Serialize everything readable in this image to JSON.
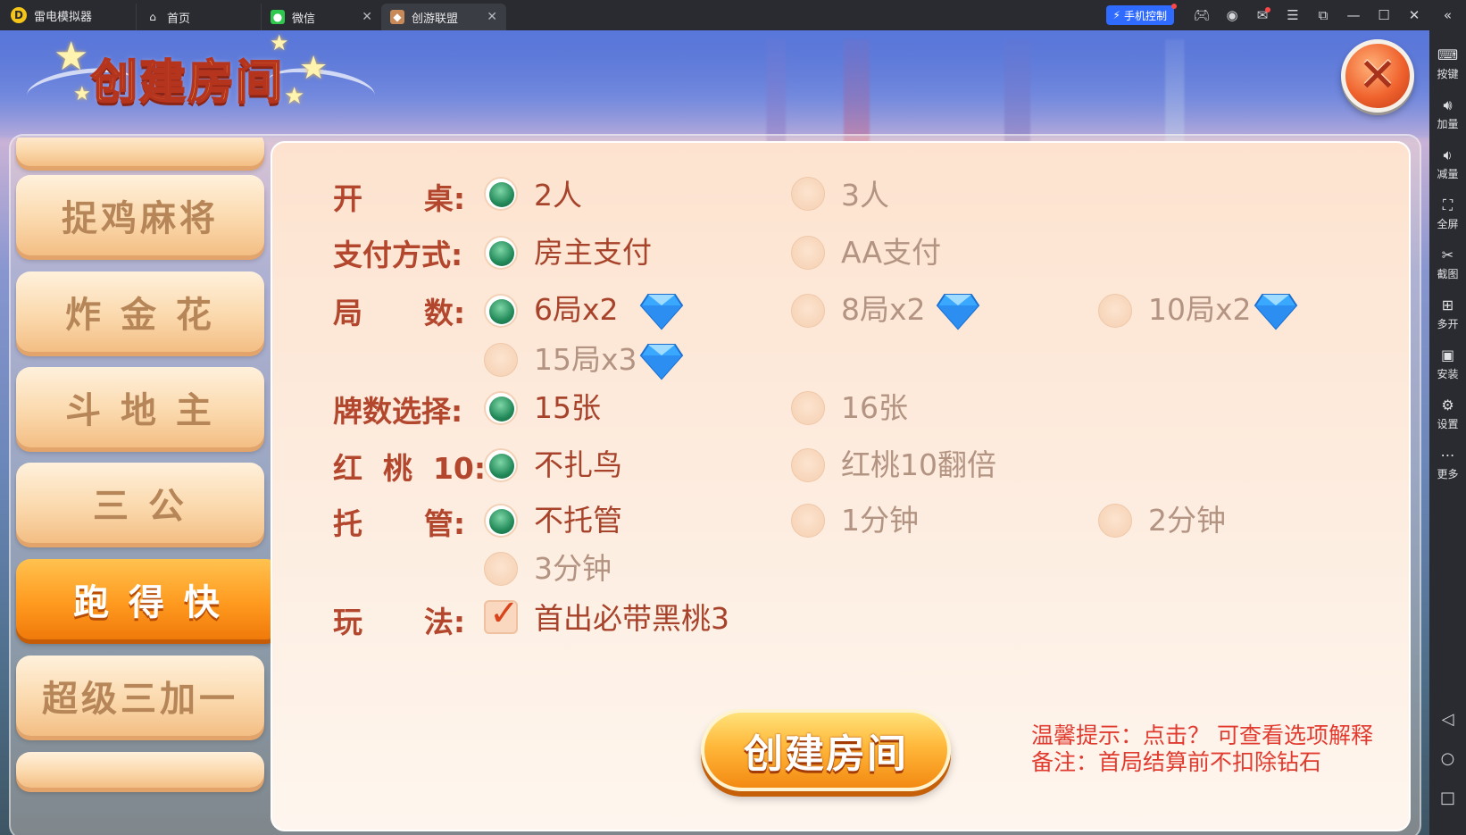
{
  "titlebar": {
    "app_name": "雷电模拟器",
    "tabs": [
      {
        "label": "首页",
        "icon": "home-icon"
      },
      {
        "label": "微信",
        "icon": "wechat-icon"
      },
      {
        "label": "创游联盟",
        "icon": "game-icon"
      }
    ],
    "phone_control": "手机控制",
    "colors": {
      "bar": "#2a2b30",
      "accent": "#2f6bff"
    }
  },
  "sidebar": {
    "items": [
      {
        "label": "按键",
        "icon": "keyboard-icon"
      },
      {
        "label": "加量",
        "icon": "volume-up-icon"
      },
      {
        "label": "减量",
        "icon": "volume-down-icon"
      },
      {
        "label": "全屏",
        "icon": "fullscreen-icon"
      },
      {
        "label": "截图",
        "icon": "scissors-icon"
      },
      {
        "label": "多开",
        "icon": "multi-instance-icon"
      },
      {
        "label": "安装",
        "icon": "apk-icon"
      },
      {
        "label": "设置",
        "icon": "gear-icon"
      },
      {
        "label": "更多",
        "icon": "more-icon"
      }
    ]
  },
  "game": {
    "title": "创建房间",
    "menu": [
      {
        "label": ""
      },
      {
        "label": "捉鸡麻将"
      },
      {
        "label": "炸 金 花"
      },
      {
        "label": "斗 地 主"
      },
      {
        "label": "三 公"
      },
      {
        "label": "跑 得 快",
        "active": true
      },
      {
        "label": "超级三加一"
      },
      {
        "label": ""
      }
    ],
    "options": {
      "table": {
        "label": "开      桌:",
        "choices": [
          "2人",
          "3人"
        ],
        "selected": 0
      },
      "payment": {
        "label": "支付方式:",
        "choices": [
          "房主支付",
          "AA支付"
        ],
        "selected": 0
      },
      "rounds": {
        "label": "局      数:",
        "choices": [
          "6局x2",
          "8局x2",
          "10局x2",
          "15局x3"
        ],
        "selected": 0
      },
      "cards": {
        "label": "牌数选择:",
        "choices": [
          "15张",
          "16张"
        ],
        "selected": 0
      },
      "hearts10": {
        "label": "红  桃  10:",
        "choices": [
          "不扎鸟",
          "红桃10翻倍"
        ],
        "selected": 0
      },
      "auto": {
        "label": "托      管:",
        "choices": [
          "不托管",
          "1分钟",
          "2分钟",
          "3分钟"
        ],
        "selected": 0
      },
      "rules": {
        "label": "玩      法:",
        "checkbox": "首出必带黑桃3",
        "checked": true
      }
    },
    "create_button": "创建房间",
    "tips": [
      "温馨提示：点击？ 可查看选项解释",
      "备注：首局结算前不扣除钻石"
    ],
    "colors": {
      "label": "#b3472e",
      "radio_on": "#238a5a",
      "button": "#f38a12",
      "tip": "#e13b30"
    }
  }
}
